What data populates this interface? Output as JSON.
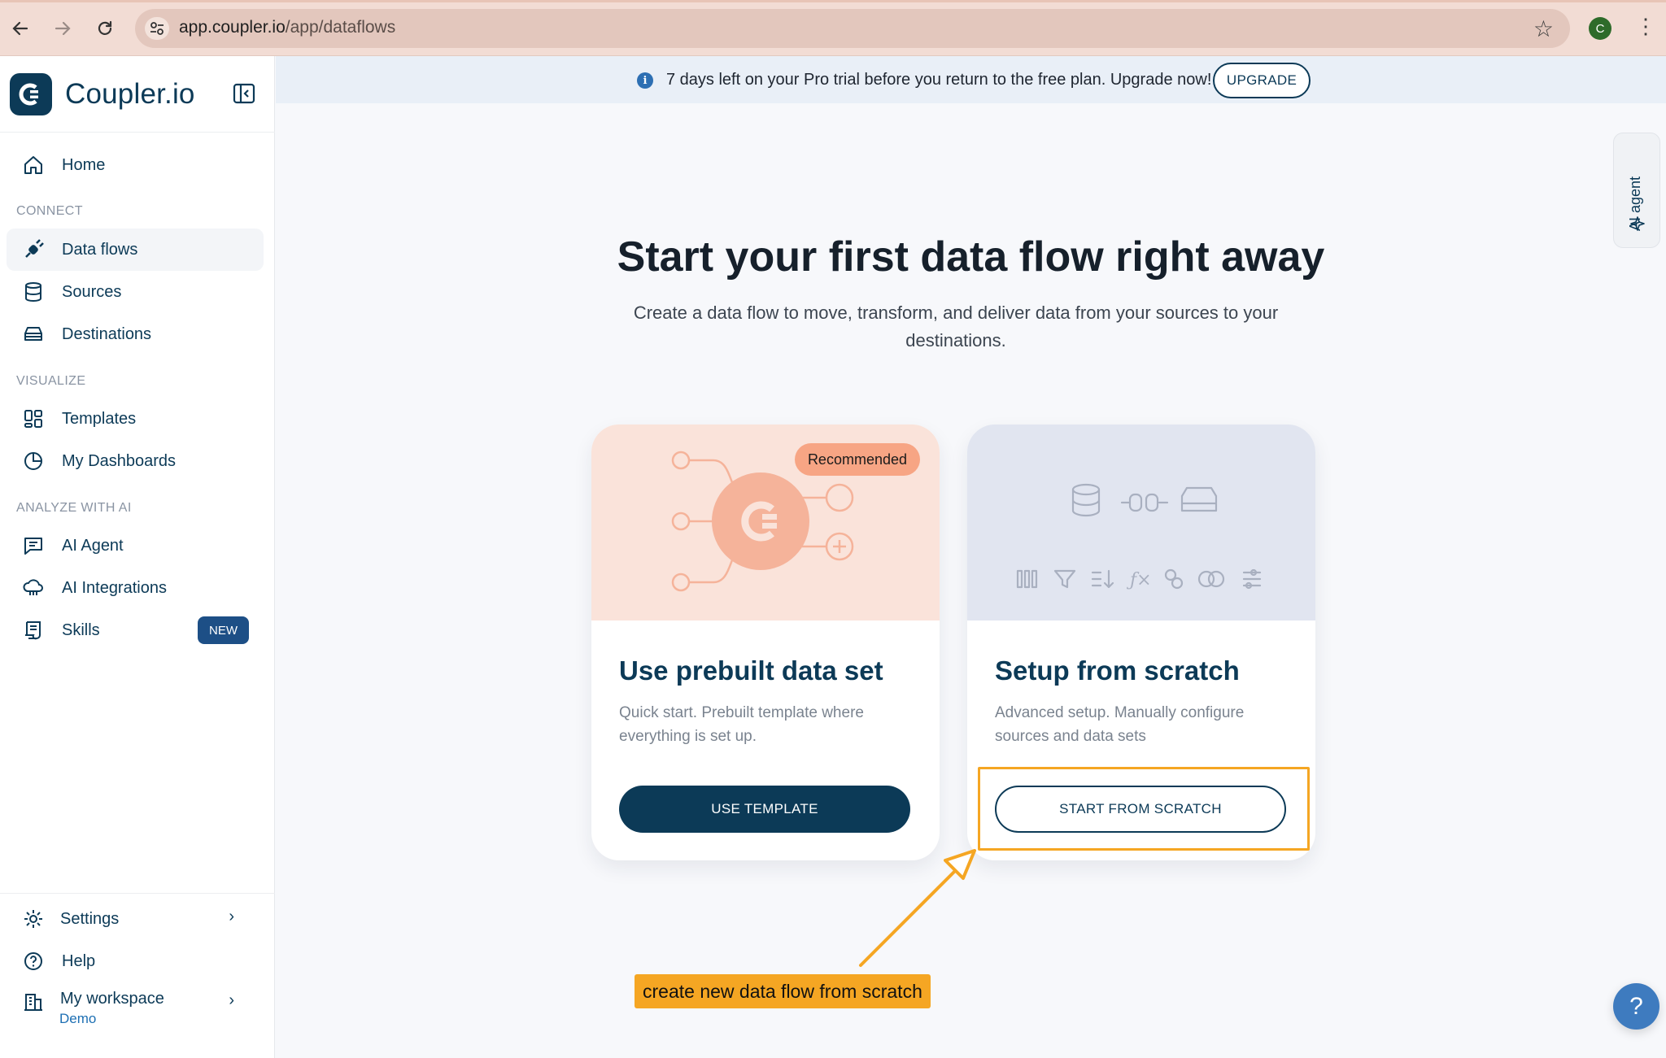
{
  "browser": {
    "url_host": "app.coupler.io",
    "url_path": "/app/dataflows",
    "profile_initial": "C"
  },
  "sidebar": {
    "brand_name": "Coupler.io",
    "home_label": "Home",
    "sections": {
      "connect": "CONNECT",
      "visualize": "VISUALIZE",
      "analyze": "ANALYZE WITH AI"
    },
    "items": {
      "data_flows": "Data flows",
      "sources": "Sources",
      "destinations": "Destinations",
      "templates": "Templates",
      "my_dashboards": "My Dashboards",
      "ai_agent": "AI Agent",
      "ai_integrations": "AI Integrations",
      "skills": "Skills"
    },
    "skills_badge": "NEW",
    "bottom": {
      "settings": "Settings",
      "help": "Help",
      "workspace": "My workspace",
      "workspace_sub": "Demo"
    }
  },
  "banner": {
    "text": "7 days left on your Pro trial before you return to the free plan. Upgrade now!",
    "upgrade_label": "UPGRADE"
  },
  "ai_agent_tab": "AI agent",
  "hero": {
    "title": "Start your first data flow right away",
    "subtitle": "Create a data flow to move, transform, and deliver data from your sources to your destinations."
  },
  "cards": {
    "prebuilt": {
      "badge": "Recommended",
      "title": "Use prebuilt data set",
      "description": "Quick start. Prebuilt template where everything is set up.",
      "button": "USE TEMPLATE"
    },
    "scratch": {
      "title": "Setup from scratch",
      "description": "Advanced setup. Manually configure sources and data sets",
      "button": "START FROM SCRATCH"
    }
  },
  "annotation": {
    "callout_text": "create new data flow from scratch",
    "color": "#f5a623"
  },
  "help_fab": "?",
  "colors": {
    "brand": "#0c3a57",
    "accent_peach": "#f7a584",
    "banner_bg": "#e9eff7"
  }
}
